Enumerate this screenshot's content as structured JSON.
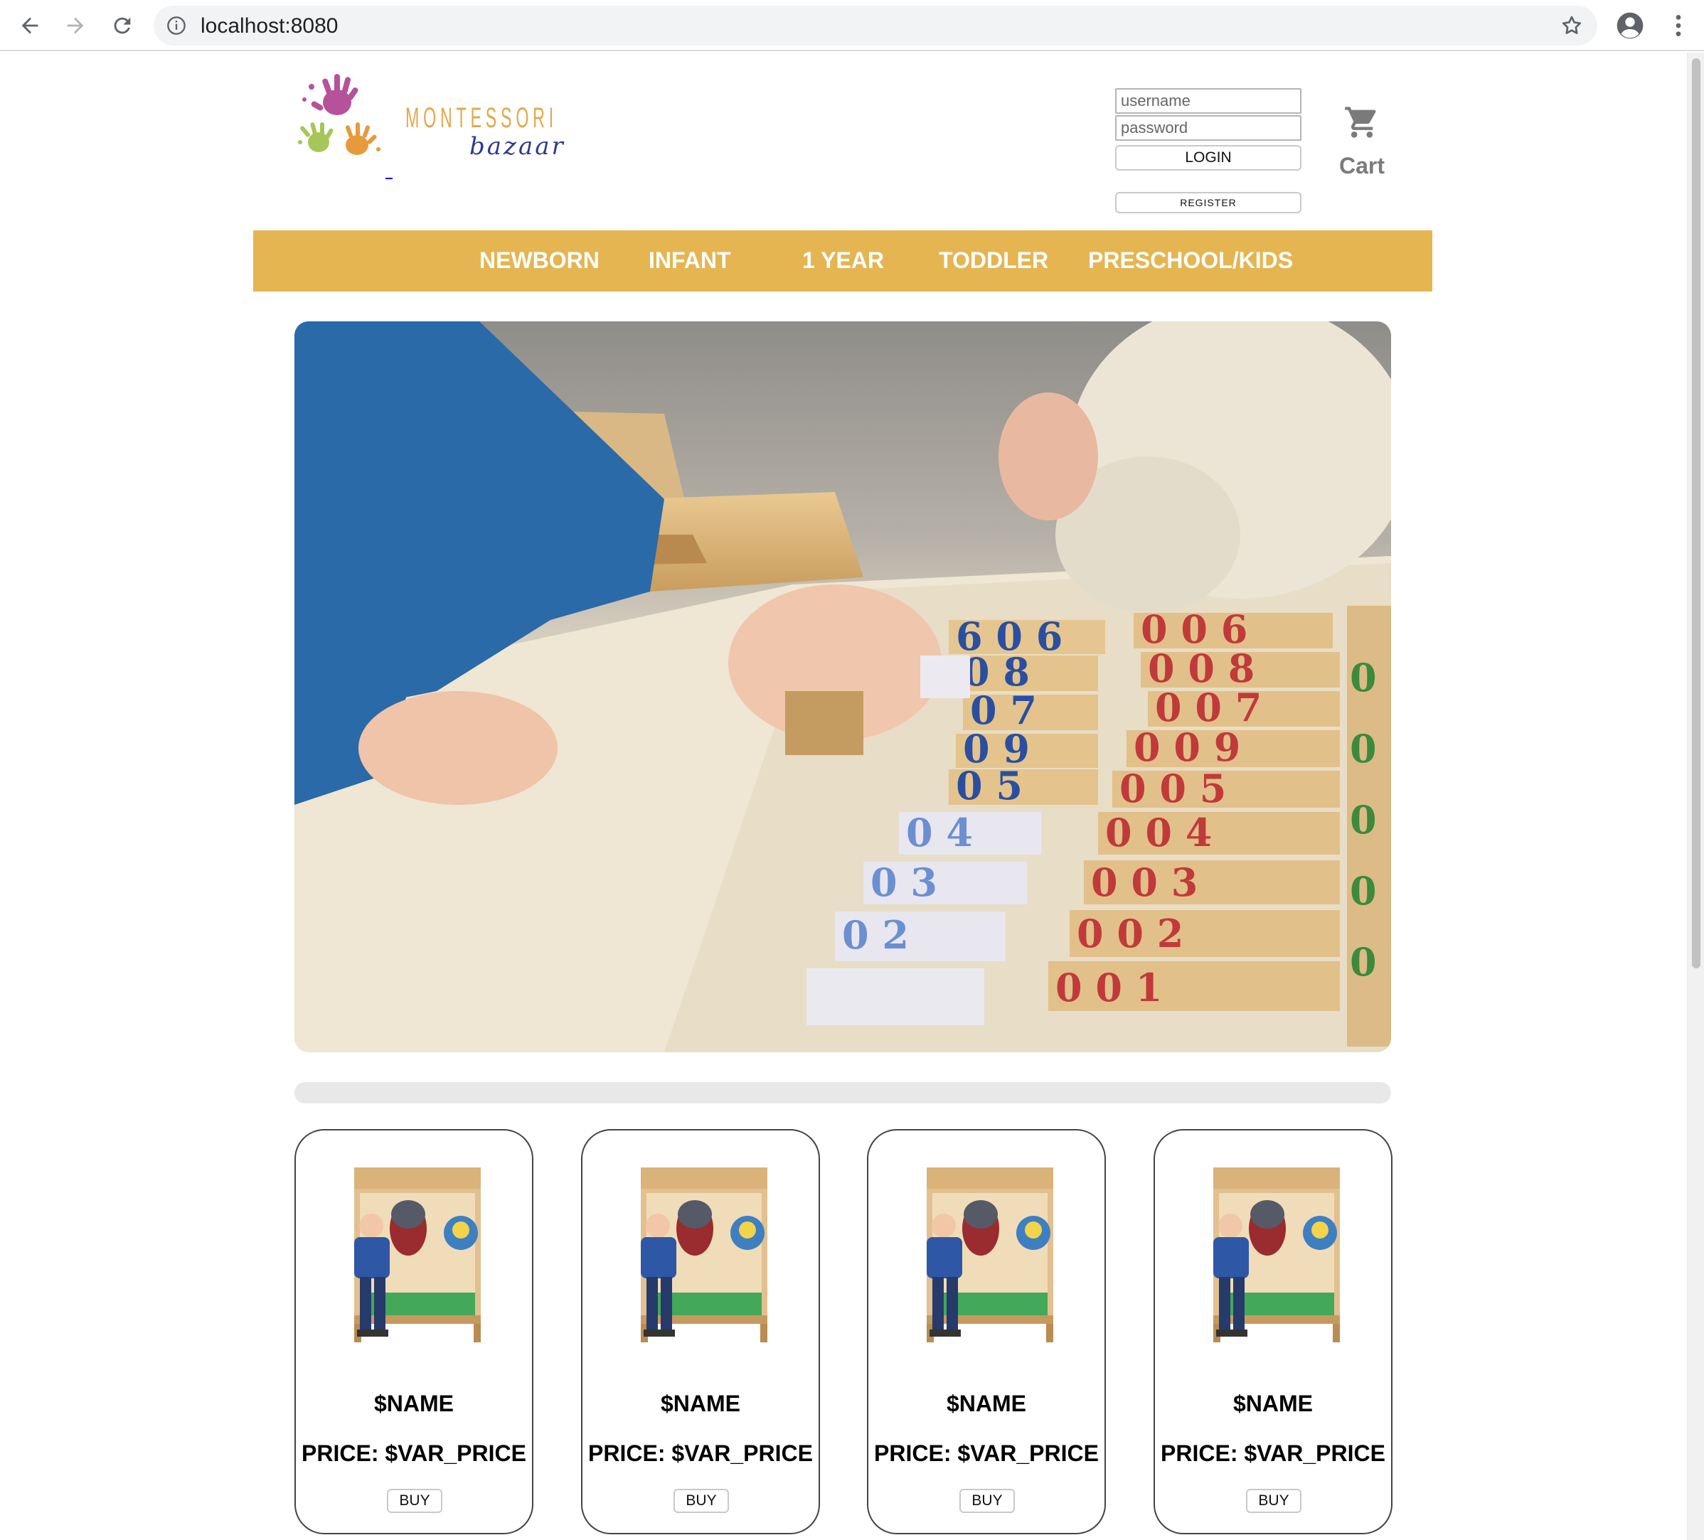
{
  "browser": {
    "url": "localhost:8080"
  },
  "header": {
    "logo_word": "MONTESSORI",
    "logo_sub": "bazaar",
    "username_placeholder": "username",
    "password_placeholder": "password",
    "login_label": "LOGIN",
    "register_label": "REGISTER",
    "cart_label": "Cart"
  },
  "categories": [
    {
      "label": "NEWBORN"
    },
    {
      "label": "INFANT"
    },
    {
      "label": "1 YEAR"
    },
    {
      "label": "TODDLER"
    },
    {
      "label": "PRESCHOOL/KIDS"
    }
  ],
  "products": [
    {
      "name": "$NAME",
      "price": "PRICE: $VAR_PRICE",
      "buy_label": "BUY"
    },
    {
      "name": "$NAME",
      "price": "PRICE: $VAR_PRICE",
      "buy_label": "BUY"
    },
    {
      "name": "$NAME",
      "price": "PRICE: $VAR_PRICE",
      "buy_label": "BUY"
    },
    {
      "name": "$NAME",
      "price": "PRICE: $VAR_PRICE",
      "buy_label": "BUY"
    }
  ],
  "colors": {
    "nav_bar": "#e5b552",
    "logo_gold": "#e3a94a",
    "logo_blue": "#2c3b8c"
  },
  "icons": [
    "back-icon",
    "forward-icon",
    "reload-icon",
    "info-icon",
    "star-icon",
    "profile-icon",
    "menu-icon",
    "cart-icon"
  ]
}
